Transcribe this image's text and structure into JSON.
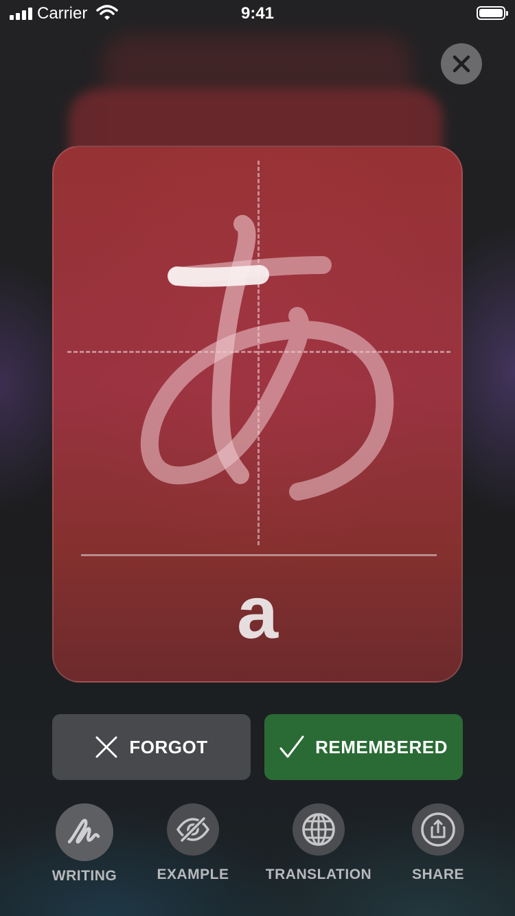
{
  "status_bar": {
    "carrier": "Carrier",
    "time": "9:41"
  },
  "card": {
    "character": "あ",
    "romaji": "a",
    "color": "#963234"
  },
  "actions": {
    "forgot_label": "FORGOT",
    "remembered_label": "REMEMBERED",
    "remembered_color": "#2a6b35"
  },
  "toolbar": {
    "items": [
      {
        "label": "WRITING",
        "icon": "handwriting-icon",
        "active": true
      },
      {
        "label": "EXAMPLE",
        "icon": "eye-slash-icon",
        "active": false
      },
      {
        "label": "TRANSLATION",
        "icon": "globe-icon",
        "active": false
      },
      {
        "label": "SHARE",
        "icon": "share-icon",
        "active": false
      }
    ]
  }
}
